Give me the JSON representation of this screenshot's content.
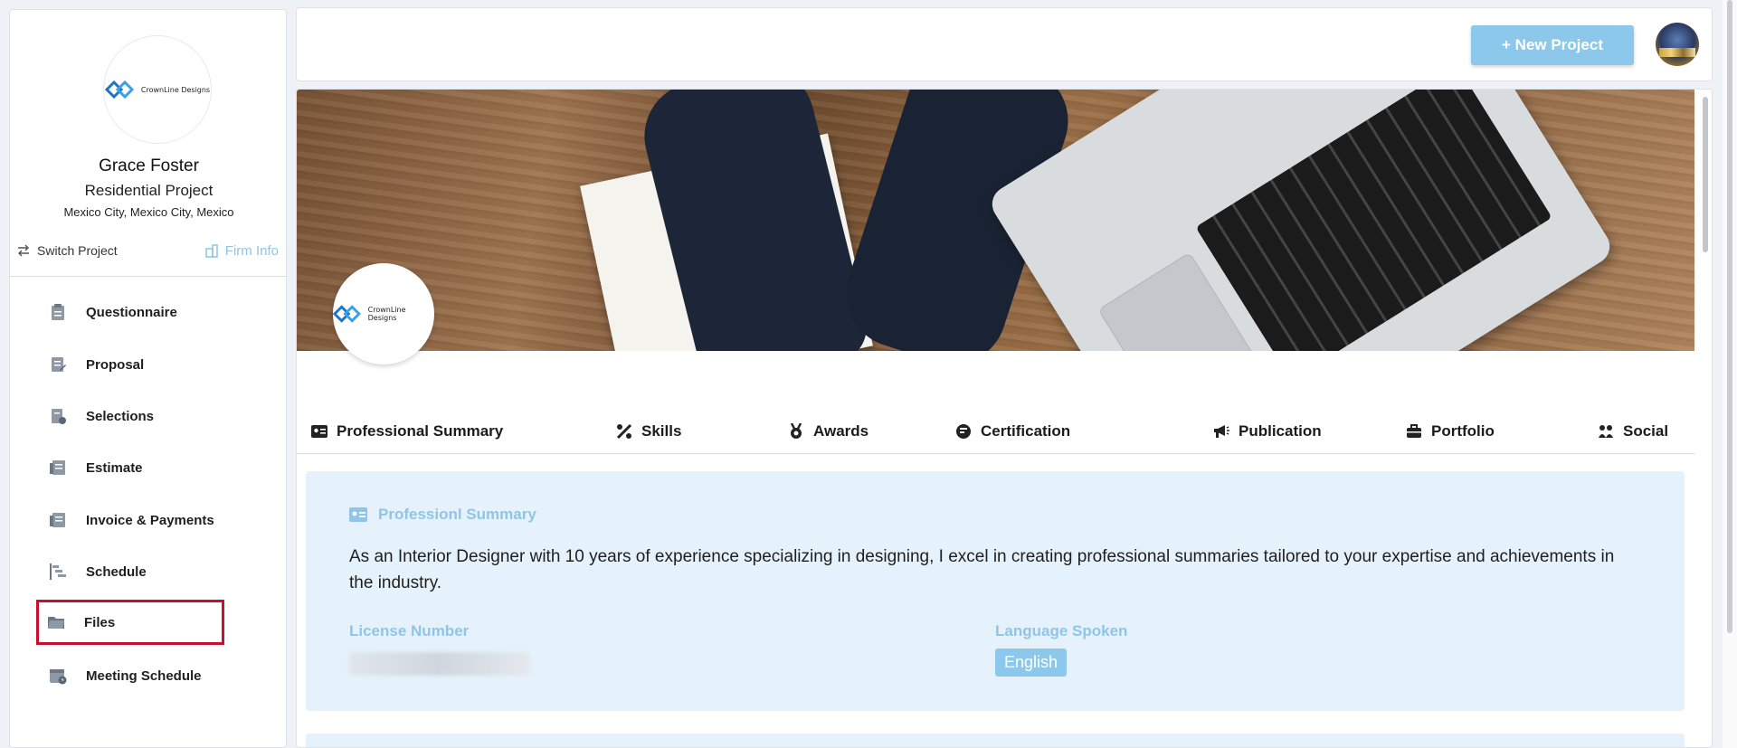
{
  "sidebar": {
    "logo_text": "CrownLine Designs",
    "name": "Grace Foster",
    "project": "Residential Project",
    "location": "Mexico City, Mexico City, Mexico",
    "switch_project": "Switch Project",
    "firm_info": "Firm Info",
    "nav": [
      {
        "label": "Questionnaire",
        "icon": "clipboard-icon"
      },
      {
        "label": "Proposal",
        "icon": "document-edit-icon"
      },
      {
        "label": "Selections",
        "icon": "document-check-icon"
      },
      {
        "label": "Estimate",
        "icon": "receipt-icon"
      },
      {
        "label": "Invoice & Payments",
        "icon": "invoice-icon"
      },
      {
        "label": "Schedule",
        "icon": "gantt-icon"
      },
      {
        "label": "Files",
        "icon": "folder-icon"
      },
      {
        "label": "Meeting Schedule",
        "icon": "calendar-icon"
      }
    ]
  },
  "header": {
    "new_project": "+ New Project"
  },
  "main": {
    "logo_text": "CrownLine Designs",
    "tabs": [
      {
        "label": "Professional Summary",
        "icon": "id-card-icon"
      },
      {
        "label": "Skills",
        "icon": "tools-icon"
      },
      {
        "label": "Awards",
        "icon": "medal-icon"
      },
      {
        "label": "Certification",
        "icon": "certificate-icon"
      },
      {
        "label": "Publication",
        "icon": "megaphone-icon"
      },
      {
        "label": "Portfolio",
        "icon": "briefcase-icon"
      },
      {
        "label": "Social",
        "icon": "people-icon"
      }
    ],
    "summary": {
      "title": "Professionl Summary",
      "text": "As an Interior Designer with 10 years of experience specializing in designing, I excel in creating professional summaries tailored to your expertise and achievements in the industry.",
      "license_label": "License Number",
      "language_label": "Language Spoken",
      "language_value": "English"
    }
  },
  "colors": {
    "accent": "#8cc8ec",
    "accent_text": "#8ec5e8",
    "card_bg": "#e6f2fb",
    "highlight_box": "#c8102e"
  }
}
